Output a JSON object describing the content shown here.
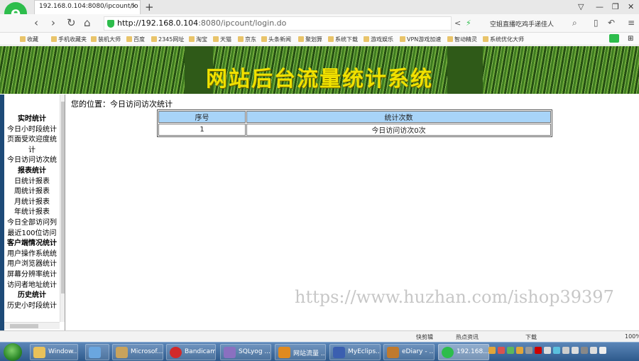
{
  "browser": {
    "tab_title": "192.168.0.104:8080/ipcount/lo",
    "url_host": "http://192.168.0.104",
    "url_rest": ":8080/ipcount/login.do",
    "search_text": "空姐直播吃鸡手递佳人",
    "bookmarks": [
      "收藏",
      "手机收藏夹",
      "装机大师",
      "百度",
      "2345网址",
      "淘宝",
      "天猫",
      "京东",
      "头条新闻",
      "聚划算",
      "系统下载",
      "游戏娱乐",
      "VPN游戏加速",
      "智动精灵",
      "系统优化大师"
    ]
  },
  "banner": {
    "title": "网站后台流量统计系统"
  },
  "sidebar": {
    "items": [
      {
        "label": "实时统计",
        "type": "h"
      },
      {
        "label": "今日小时段统计",
        "type": "i"
      },
      {
        "label": "页面受欢迎度统",
        "type": "i"
      },
      {
        "label": "计",
        "type": "i"
      },
      {
        "label": "今日访问访次统",
        "type": "i"
      },
      {
        "label": "报表统计",
        "type": "h"
      },
      {
        "label": "日统计报表",
        "type": "i"
      },
      {
        "label": "周统计报表",
        "type": "i"
      },
      {
        "label": "月统计报表",
        "type": "i"
      },
      {
        "label": "年统计报表",
        "type": "i"
      },
      {
        "label": "今日全部访问列",
        "type": "i"
      },
      {
        "label": "最近100位访问",
        "type": "i"
      },
      {
        "label": "客户端情况统计",
        "type": "h"
      },
      {
        "label": "用户操作系统统",
        "type": "i"
      },
      {
        "label": "用户浏览器统计",
        "type": "i"
      },
      {
        "label": "屏幕分辨率统计",
        "type": "i"
      },
      {
        "label": "访问者地址统计",
        "type": "i"
      },
      {
        "label": "历史统计",
        "type": "h"
      },
      {
        "label": "历史小时段统计",
        "type": "i"
      }
    ]
  },
  "main": {
    "breadcrumb": "您的位置：今日访问访次统计",
    "table": {
      "headers": [
        "序号",
        "统计次数"
      ],
      "rows": [
        [
          "1",
          "今日访问访次0次"
        ]
      ]
    }
  },
  "watermark": "https://www.huzhan.com/ishop39397",
  "statusbar": {
    "items": [
      "快剪辑",
      "热点资讯",
      "下载",
      "100%"
    ]
  },
  "taskbar": {
    "items": [
      "Window...",
      "Microsof...",
      "Bandicam",
      "SQLyog ...",
      "网站流量 ...",
      "MyEclips...",
      "eDiary - ...",
      "192.168..."
    ]
  }
}
